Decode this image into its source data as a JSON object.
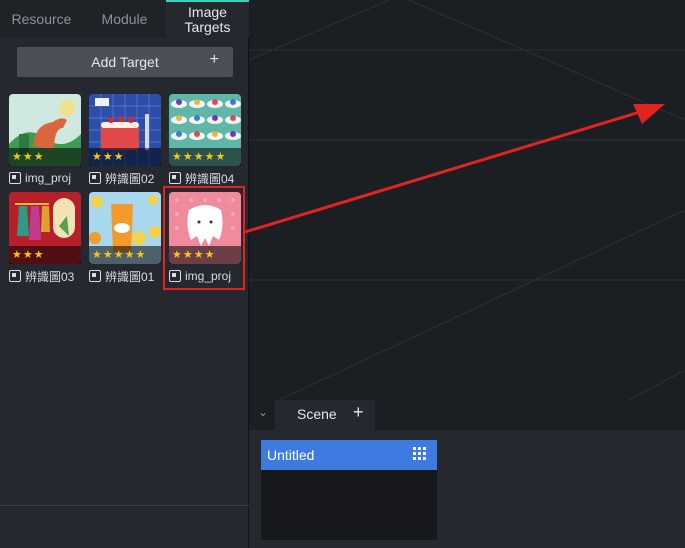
{
  "tabs": [
    {
      "label": "Resource"
    },
    {
      "label": "Module"
    },
    {
      "label": "Image Targets"
    }
  ],
  "add_target": {
    "label": "Add Target",
    "icon": "plus-icon"
  },
  "targets": [
    {
      "label": "img_proj",
      "stars": "★★★"
    },
    {
      "label": "辨識圖02",
      "stars": "★★★"
    },
    {
      "label": "辨識圖04",
      "stars": "★★★★★"
    },
    {
      "label": "辨識圖03",
      "stars": "★★★"
    },
    {
      "label": "辨識圖01",
      "stars": "★★★★★"
    },
    {
      "label": "img_proj",
      "stars": "★★★★"
    }
  ],
  "scene": {
    "title": "Scene",
    "add_icon": "+",
    "collapse_icon": "⌄",
    "items": [
      {
        "label": "Untitled"
      }
    ]
  },
  "colors": {
    "accent": "#3d7be0",
    "highlight": "#e0241e",
    "tab_indicator": "#3ad0c0"
  }
}
